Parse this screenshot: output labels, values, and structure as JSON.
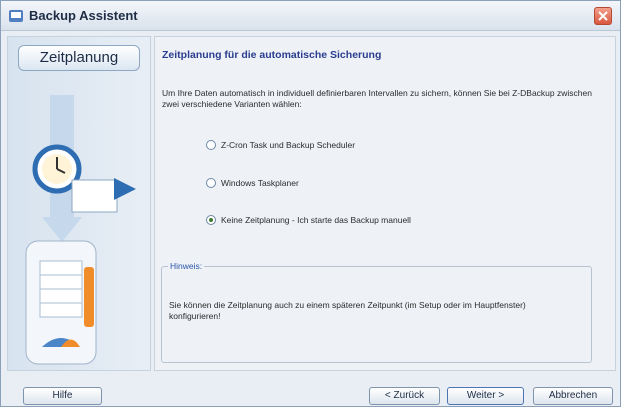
{
  "window": {
    "title": "Backup Assistent",
    "close_icon": "close-icon"
  },
  "sidebar": {
    "step_label": "Zeitplanung"
  },
  "main": {
    "heading": "Zeitplanung für die automatische Sicherung",
    "description": "Um Ihre Daten automatisch in individuell definierbaren Intervallen zu sichern, können Sie bei Z-DBackup zwischen zwei verschiedene Varianten wählen:",
    "options": [
      {
        "label": "Z-Cron Task und Backup Scheduler",
        "checked": false
      },
      {
        "label": "Windows Taskplaner",
        "checked": false
      },
      {
        "label": "Keine Zeitplanung - Ich starte das Backup manuell",
        "checked": true
      }
    ],
    "hint": {
      "legend": "Hinweis:",
      "text": "Sie können die Zeitplanung auch zu einem späteren Zeitpunkt (im Setup oder im Hauptfenster) konfigurieren!"
    }
  },
  "footer": {
    "help": "Hilfe",
    "back": "< Zurück",
    "next": "Weiter >",
    "cancel": "Abbrechen"
  },
  "colors": {
    "accent": "#2a3d8f",
    "title_bar": "#d9e2ec",
    "close": "#d9573e"
  }
}
